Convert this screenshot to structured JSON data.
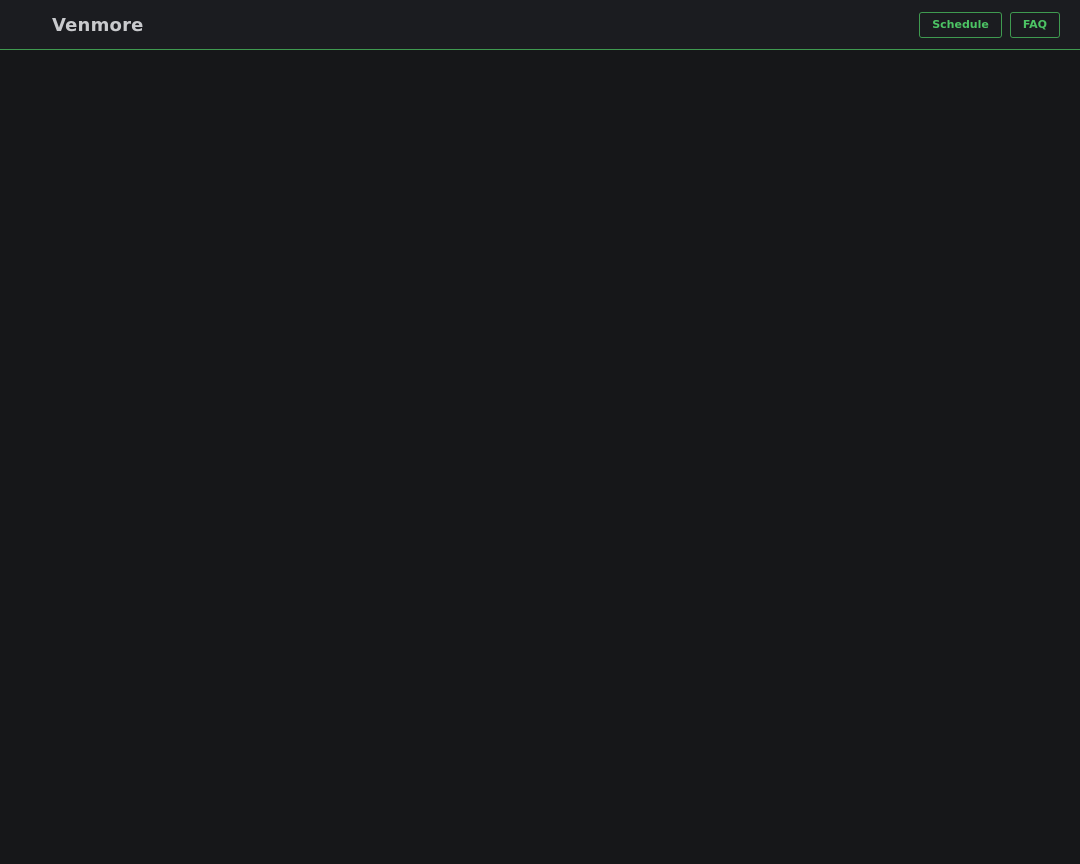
{
  "header": {
    "brand": "Venmore",
    "nav": {
      "schedule_label": "Schedule",
      "faq_label": "FAQ"
    }
  },
  "colors": {
    "background": "#161719",
    "header_background": "#1b1c20",
    "accent": "#3f9a50",
    "accent_text": "#4cc464",
    "brand_text": "#c9cacd"
  }
}
